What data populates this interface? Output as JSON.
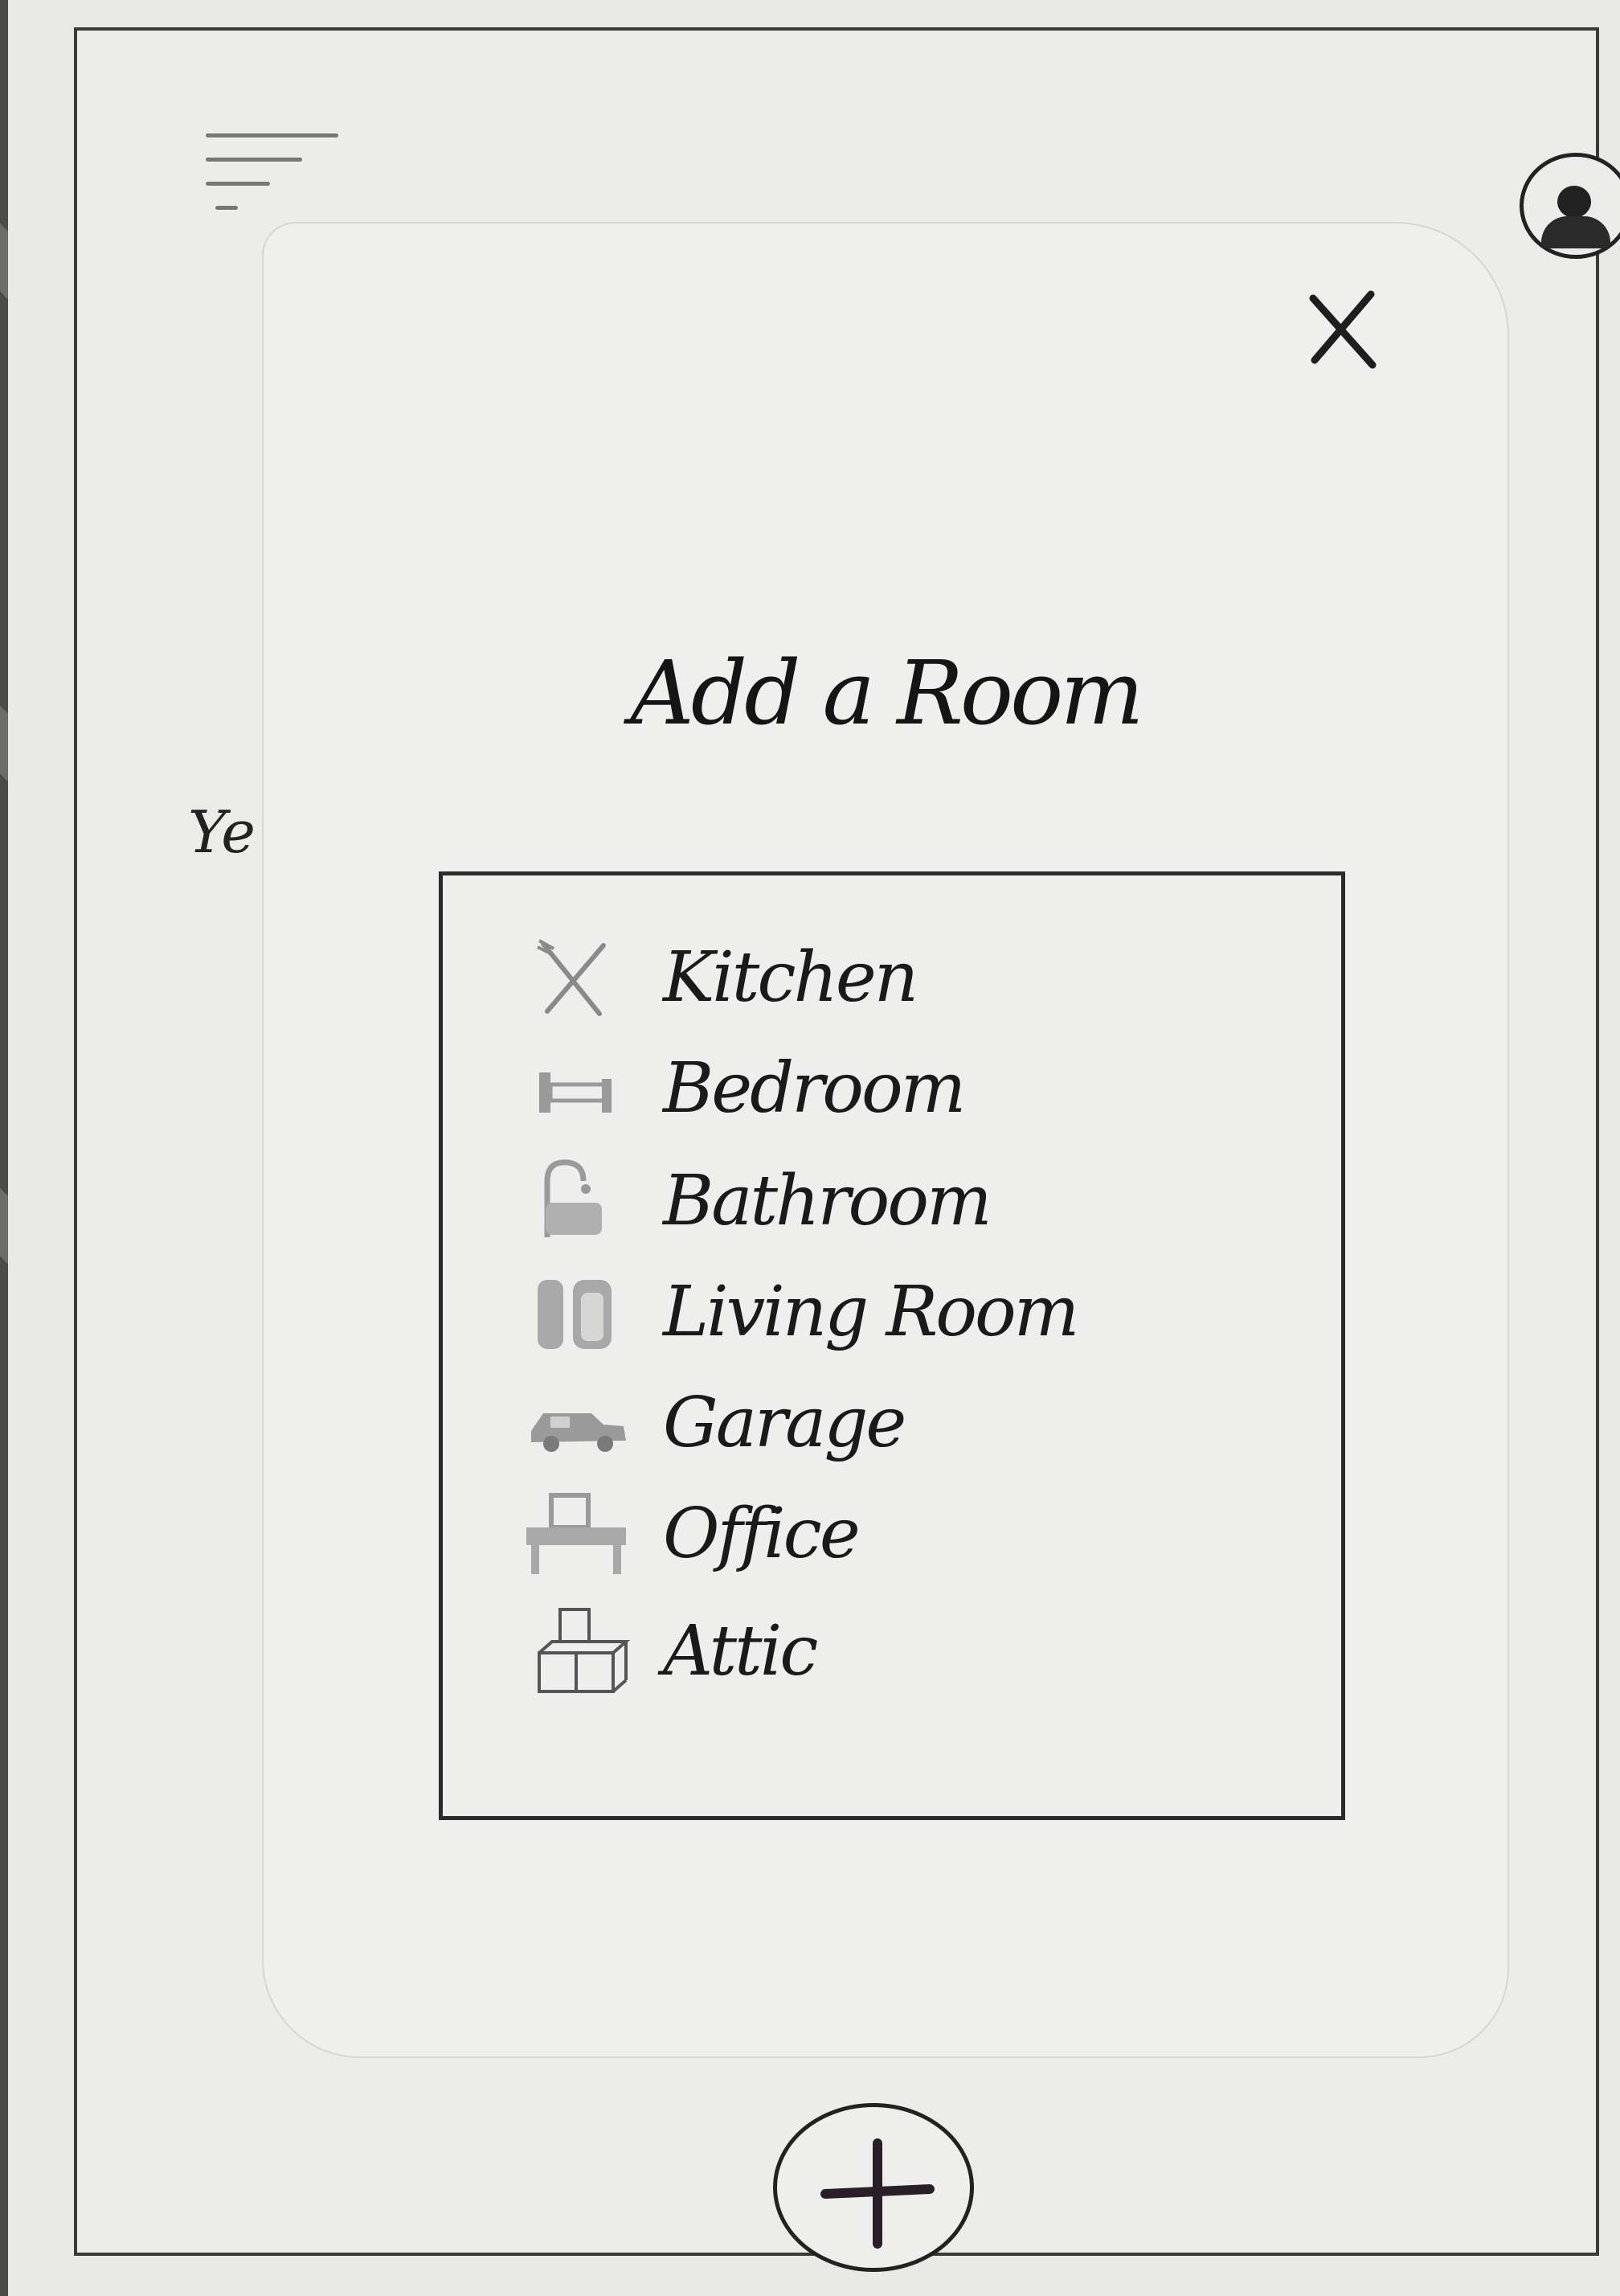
{
  "header": {
    "menu_icon": "hamburger-menu-icon",
    "profile_icon": "user-avatar-icon"
  },
  "background": {
    "partial_text": "Ye"
  },
  "modal": {
    "title": "Add a Room",
    "close_icon": "close-x-icon",
    "rooms": [
      {
        "label": "Kitchen",
        "icon": "fork-knife-icon"
      },
      {
        "label": "Bedroom",
        "icon": "bed-icon"
      },
      {
        "label": "Bathroom",
        "icon": "bathtub-icon"
      },
      {
        "label": "Living Room",
        "icon": "armchair-icon"
      },
      {
        "label": "Garage",
        "icon": "car-icon"
      },
      {
        "label": "Office",
        "icon": "desk-computer-icon"
      },
      {
        "label": "Attic",
        "icon": "boxes-icon"
      }
    ]
  },
  "fab": {
    "icon": "plus-icon"
  },
  "colors": {
    "ink": "#1a1a1a",
    "pencil": "#8a8a8a",
    "paper": "#ecece9"
  }
}
